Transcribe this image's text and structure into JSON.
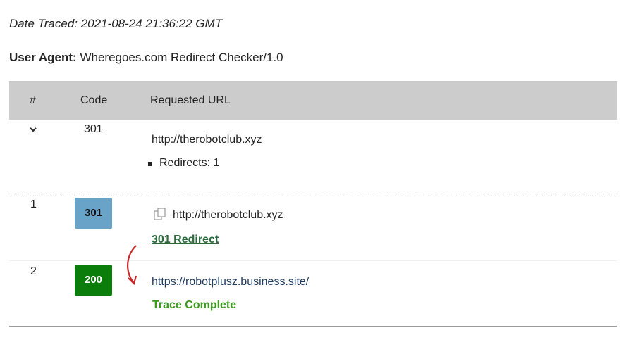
{
  "header": {
    "date_traced": "Date Traced: 2021-08-24 21:36:22 GMT",
    "user_agent_label": "User Agent:",
    "user_agent_value": "Wheregoes.com Redirect Checker/1.0"
  },
  "table": {
    "columns": [
      "#",
      "Code",
      "Requested URL"
    ],
    "summary": {
      "code": "301",
      "url": "http://therobotclub.xyz",
      "redirects": "Redirects: 1"
    },
    "rows": [
      {
        "index": "1",
        "code": "301",
        "url": "http://therobotclub.xyz",
        "status": "301 Redirect",
        "badge_color": "#6aa3c8"
      },
      {
        "index": "2",
        "code": "200",
        "url": "https://robotplusz.business.site/",
        "status": "Trace Complete",
        "badge_color": "#0a7d0a"
      }
    ]
  },
  "icons": {
    "expand": "chevron-down-icon",
    "copy": "copy-icon",
    "redirect_arrow": "redirect-arrow-icon"
  }
}
